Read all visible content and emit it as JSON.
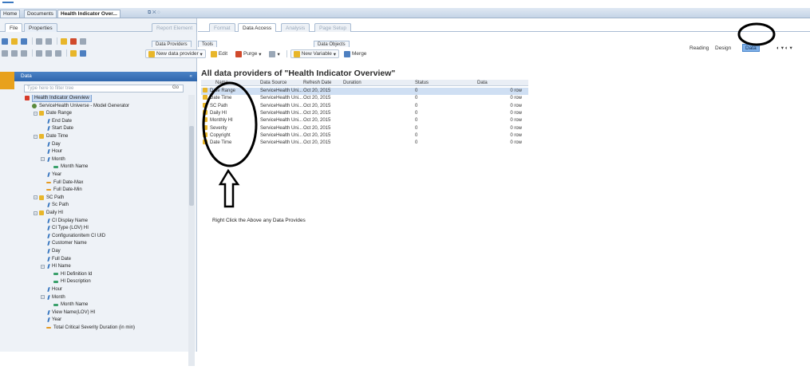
{
  "document_tabs": [
    "Home",
    "Documents",
    "Health Indicator Over..."
  ],
  "ribbon_tabs_left": [
    "File",
    "Properties"
  ],
  "ribbon_tabs_right": [
    "Report Element",
    "Format",
    "Data Access",
    "Analysis",
    "Page Setup"
  ],
  "sub_tabs": [
    "Data Providers",
    "Tools",
    "Data Objects"
  ],
  "toolbar": {
    "new_data_provider": "New data provider",
    "edit": "Edit",
    "purge": "Purge",
    "new_variable": "New Variable",
    "merge": "Merge"
  },
  "view_modes": {
    "reading": "Reading",
    "design": "Design",
    "data": "Data"
  },
  "left_panel": {
    "title": "Data",
    "filter_placeholder": "Type here to filter tree",
    "filter_button": "Go",
    "tree": [
      {
        "label": "Health Indicator Overview",
        "level": 0,
        "icon": "root",
        "sel": true
      },
      {
        "label": "ServiceHealth Universe - Model Generator",
        "level": 1,
        "icon": "uni"
      },
      {
        "label": "Date Range",
        "level": 2,
        "icon": "folder",
        "exp": true
      },
      {
        "label": "End Date",
        "level": 3,
        "icon": "dim"
      },
      {
        "label": "Start Date",
        "level": 3,
        "icon": "dim"
      },
      {
        "label": "Date Time",
        "level": 2,
        "icon": "folder",
        "exp": true
      },
      {
        "label": "Day",
        "level": 3,
        "icon": "dim"
      },
      {
        "label": "Hour",
        "level": 3,
        "icon": "dim"
      },
      {
        "label": "Month",
        "level": 3,
        "icon": "dim",
        "exp": true
      },
      {
        "label": "Month Name",
        "level": 4,
        "icon": "det"
      },
      {
        "label": "Year",
        "level": 3,
        "icon": "dim"
      },
      {
        "label": "Full Date-Max",
        "level": 3,
        "icon": "measure"
      },
      {
        "label": "Full Date-Min",
        "level": 3,
        "icon": "measure"
      },
      {
        "label": "SC Path",
        "level": 2,
        "icon": "folder",
        "exp": true
      },
      {
        "label": "Sc Path",
        "level": 3,
        "icon": "dim"
      },
      {
        "label": "Daily HI",
        "level": 2,
        "icon": "folder",
        "exp": true
      },
      {
        "label": "CI Display Name",
        "level": 3,
        "icon": "dim"
      },
      {
        "label": "CI Type (LOV) HI",
        "level": 3,
        "icon": "dim"
      },
      {
        "label": "ConfigurationItem CI UID",
        "level": 3,
        "icon": "dim"
      },
      {
        "label": "Customer Name",
        "level": 3,
        "icon": "dim"
      },
      {
        "label": "Day",
        "level": 3,
        "icon": "dim"
      },
      {
        "label": "Full Date",
        "level": 3,
        "icon": "dim"
      },
      {
        "label": "HI Name",
        "level": 3,
        "icon": "dim",
        "exp": true
      },
      {
        "label": "HI Definition Id",
        "level": 4,
        "icon": "det"
      },
      {
        "label": "HI Description",
        "level": 4,
        "icon": "det"
      },
      {
        "label": "Hour",
        "level": 3,
        "icon": "dim"
      },
      {
        "label": "Month",
        "level": 3,
        "icon": "dim",
        "exp": true
      },
      {
        "label": "Month Name",
        "level": 4,
        "icon": "det"
      },
      {
        "label": "View Name(LOV) HI",
        "level": 3,
        "icon": "dim"
      },
      {
        "label": "Year",
        "level": 3,
        "icon": "dim"
      },
      {
        "label": "Total Critical Severity Duration (in min)",
        "level": 3,
        "icon": "measure"
      }
    ]
  },
  "main": {
    "title": "All data providers of \"Health Indicator Overview\"",
    "columns": [
      "Name",
      "Data Source",
      "Refresh Date",
      "Duration",
      "Status",
      "Data"
    ],
    "rows": [
      {
        "name": "Date Range",
        "source": "ServiceHealth Uni...",
        "date": "Oct 20, 2015",
        "status": "0",
        "data": "0 row",
        "sel": true
      },
      {
        "name": "Date Time",
        "source": "ServiceHealth Uni...",
        "date": "Oct 20, 2015",
        "status": "0",
        "data": "0 row"
      },
      {
        "name": "SC Path",
        "source": "ServiceHealth Uni...",
        "date": "Oct 20, 2015",
        "status": "0",
        "data": "0 row"
      },
      {
        "name": "Daily HI",
        "source": "ServiceHealth Uni...",
        "date": "Oct 20, 2015",
        "status": "0",
        "data": "0 row"
      },
      {
        "name": "Monthly HI",
        "source": "ServiceHealth Uni...",
        "date": "Oct 20, 2015",
        "status": "0",
        "data": "0 row"
      },
      {
        "name": "Severity",
        "source": "ServiceHealth Uni...",
        "date": "Oct 20, 2015",
        "status": "0",
        "data": "0 row"
      },
      {
        "name": "Copyright",
        "source": "ServiceHealth Uni...",
        "date": "Oct 20, 2015",
        "status": "0",
        "data": "0 row"
      },
      {
        "name": "Date Time",
        "source": "ServiceHealth Uni...",
        "date": "Oct 20, 2015",
        "status": "0",
        "data": "0 row"
      }
    ],
    "annotation": "Right Click the Above any Data Provides"
  },
  "colors": {
    "header_blue": "#2f66ad",
    "selection": "#cfdff3",
    "folder_yellow": "#e8b62a"
  }
}
